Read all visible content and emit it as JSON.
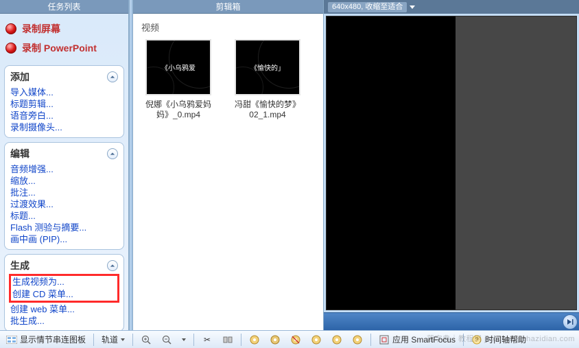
{
  "sidebar": {
    "title": "任务列表",
    "top_actions": [
      {
        "label": "录制屏幕"
      },
      {
        "label": "录制 PowerPoint"
      }
    ],
    "panels": {
      "add": {
        "title": "添加",
        "items": [
          "导入媒体...",
          "标题剪辑...",
          "语音旁白...",
          "录制摄像头..."
        ]
      },
      "edit": {
        "title": "编辑",
        "items": [
          "音频增强...",
          "缩放...",
          "批注...",
          "过渡效果...",
          "标题...",
          "Flash 测验与摘要...",
          "画中画 (PIP)..."
        ]
      },
      "produce": {
        "title": "生成",
        "items": [
          "生成视频为...",
          "创建 CD 菜单...",
          "创建 web 菜单...",
          "批生成..."
        ]
      }
    }
  },
  "library": {
    "title": "剪辑箱",
    "section_label": "视频",
    "clips": [
      {
        "thumb_text": "《小乌鸦爱",
        "label_line1": "倪娜《小乌鸦爱妈",
        "label_line2": "妈》_0.mp4"
      },
      {
        "thumb_text": "《愉快的」",
        "label_line1": "冯甜《愉快的梦》",
        "label_line2": "02_1.mp4"
      }
    ]
  },
  "preview": {
    "info": "640x480, 收缩至适合"
  },
  "toolbar": {
    "show_storyboard": "显示情节串连图板",
    "track": "轨道",
    "apply_smartfocus": "应用 SmartFocus",
    "timeline_help": "时间轴帮助"
  },
  "watermark": "落字典｜教程网  jiaocheng.chazidian.com"
}
